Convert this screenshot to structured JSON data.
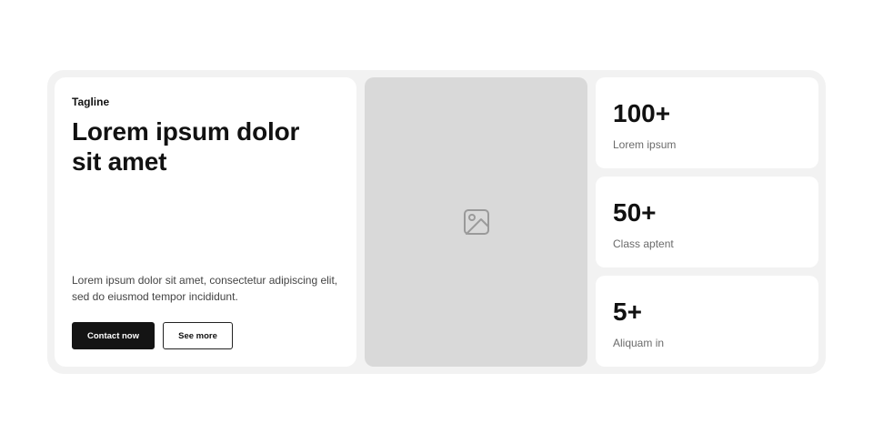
{
  "hero": {
    "tagline": "Tagline",
    "headline": "Lorem ipsum dolor sit amet",
    "description": "Lorem ipsum dolor sit amet, consectetur adipiscing elit, sed do eiusmod tempor incididunt.",
    "primary_button": "Contact now",
    "secondary_button": "See more"
  },
  "media": {
    "icon": "image-placeholder-icon"
  },
  "stats": [
    {
      "value": "100+",
      "label": "Lorem ipsum"
    },
    {
      "value": "50+",
      "label": "Class aptent"
    },
    {
      "value": "5+",
      "label": "Aliquam in"
    }
  ],
  "colors": {
    "frame_background": "#f2f2f2",
    "card_background": "#ffffff",
    "image_placeholder": "#d9d9d9",
    "primary_button": "#141414",
    "text_primary": "#111111",
    "text_muted": "#6b6b6b"
  }
}
